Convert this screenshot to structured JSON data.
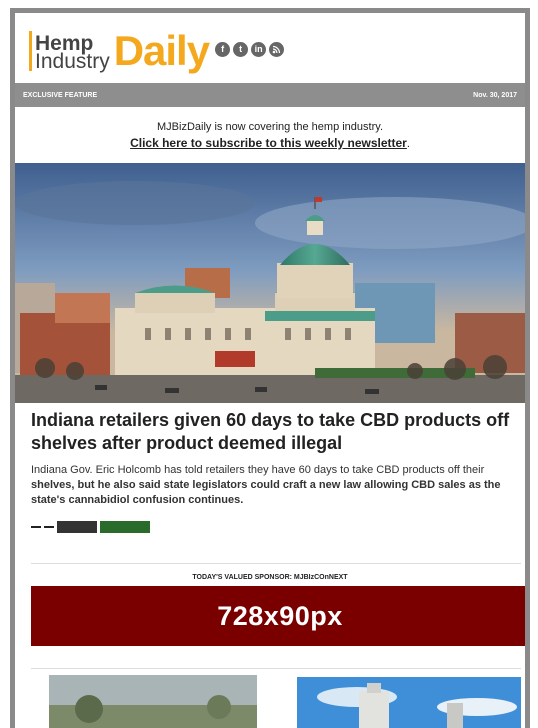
{
  "logo": {
    "line1": "Hemp",
    "line2": "Industry",
    "line3": "Daily"
  },
  "social_icons": [
    "facebook-icon",
    "twitter-icon",
    "linkedin-icon",
    "rss-icon"
  ],
  "strip": {
    "left": "EXCLUSIVE FEATURE",
    "right": "Nov. 30, 2017"
  },
  "notice": {
    "line": "MJBizDaily is now covering the hemp industry.",
    "link": "Click here to subscribe to this weekly newsletter",
    "punct": "."
  },
  "article": {
    "headline": "Indiana retailers given 60 days to take CBD products off shelves after product deemed illegal",
    "summary_regular": "Indiana Gov. Eric Holcomb has told retailers they have 60 days to take CBD products off their",
    "summary_bold": "shelves, but he also said state legislators could craft a new law allowing CBD sales as the state's cannabidiol confusion continues."
  },
  "sponsor": {
    "label": "TODAY'S VALUED SPONSOR: MJBIzCOnNEXT",
    "ad_text": "728x90px"
  },
  "colors": {
    "accent": "#f4a81d",
    "strip": "#8e8e8e",
    "ad_bg": "#7a0000"
  }
}
